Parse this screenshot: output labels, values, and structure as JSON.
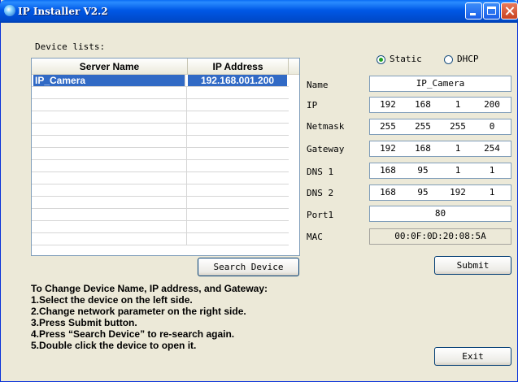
{
  "window": {
    "title": "IP Installer V2.2"
  },
  "device_lists": {
    "label": "Device lists:",
    "columns": [
      "Server Name",
      "IP Address"
    ],
    "rows": [
      {
        "name": "IP_Camera",
        "ip": "192.168.001.200"
      }
    ]
  },
  "mode": {
    "static_label": "Static",
    "dhcp_label": "DHCP",
    "selected": "Static"
  },
  "settings": {
    "name": {
      "label": "Name",
      "value": "IP_Camera"
    },
    "ip": {
      "label": "IP",
      "octets": [
        "192",
        "168",
        "1",
        "200"
      ]
    },
    "netmask": {
      "label": "Netmask",
      "octets": [
        "255",
        "255",
        "255",
        "0"
      ]
    },
    "gateway": {
      "label": "Gateway",
      "octets": [
        "192",
        "168",
        "1",
        "254"
      ]
    },
    "dns1": {
      "label": "DNS 1",
      "octets": [
        "168",
        "95",
        "1",
        "1"
      ]
    },
    "dns2": {
      "label": "DNS 2",
      "octets": [
        "168",
        "95",
        "192",
        "1"
      ]
    },
    "port1": {
      "label": "Port1",
      "value": "80"
    },
    "mac": {
      "label": "MAC",
      "value": "00:0F:0D:20:08:5A"
    }
  },
  "buttons": {
    "search": "Search Device",
    "submit": "Submit",
    "exit": "Exit"
  },
  "instructions": [
    "To Change Device Name, IP address, and Gateway:",
    "1.Select the device on the left side.",
    "2.Change network parameter on the right side.",
    "3.Press Submit button.",
    "4.Press “Search Device” to re-search again.",
    "5.Double click the device to open it."
  ]
}
